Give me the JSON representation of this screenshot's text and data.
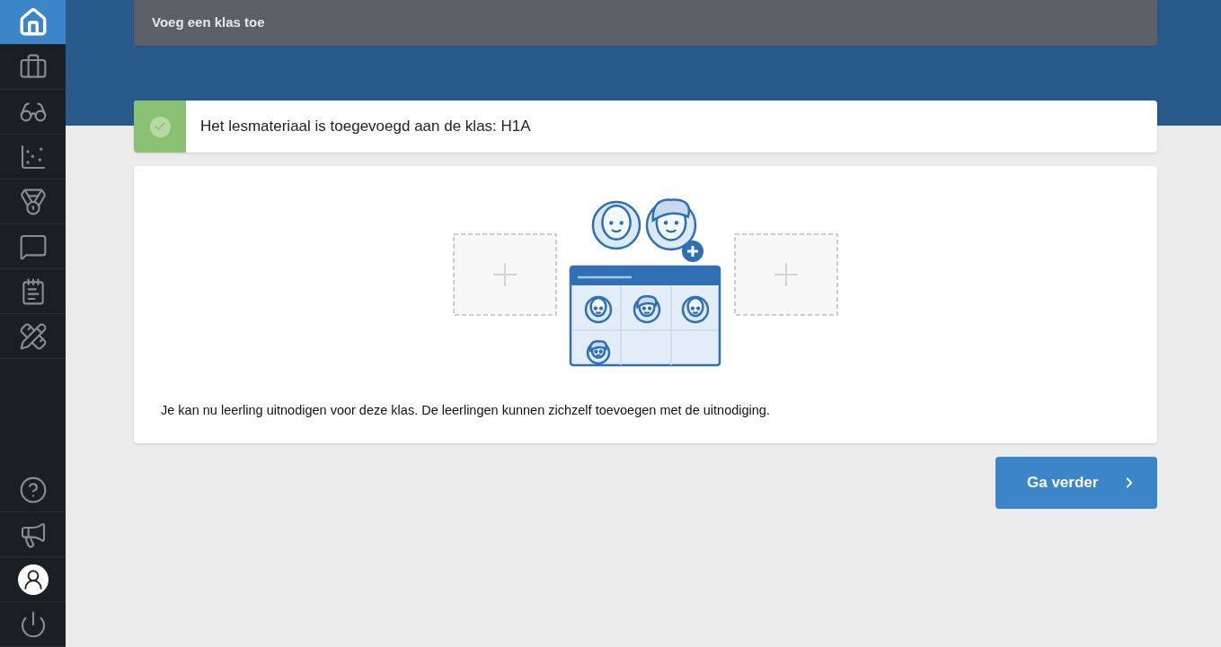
{
  "sidebar": {
    "items": [
      {
        "kind": "home",
        "selected": true
      },
      {
        "kind": "briefcase",
        "selected": false
      },
      {
        "kind": "glasses",
        "selected": false
      },
      {
        "kind": "scatter",
        "selected": false
      },
      {
        "kind": "medal",
        "selected": false
      },
      {
        "kind": "chat",
        "selected": false
      },
      {
        "kind": "notepad",
        "selected": false
      },
      {
        "kind": "tools",
        "selected": false
      }
    ],
    "bottom_items": [
      {
        "kind": "help",
        "selected": false
      },
      {
        "kind": "megaphone",
        "selected": false
      },
      {
        "kind": "avatar",
        "selected": false
      },
      {
        "kind": "power",
        "selected": false
      }
    ]
  },
  "header": {
    "title": "Voeg een klas toe"
  },
  "alert": {
    "kind": "success",
    "message": "Het lesmateriaal is toegevoegd aan de klas: H1A"
  },
  "card": {
    "text": "Je kan nu leerling uitnodigen voor deze klas. De leerlingen kunnen zichzelf toevoegen met de uitnodiging."
  },
  "continue_button": {
    "label": "Ga verder"
  }
}
